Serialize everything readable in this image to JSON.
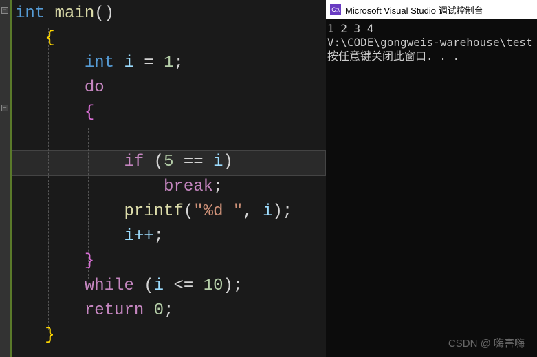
{
  "editor": {
    "tokens": {
      "t_int": "int",
      "t_main": "main",
      "t_lpar": "(",
      "t_rpar": ")",
      "t_lbrace": "{",
      "t_rbrace": "}",
      "t_i": "i",
      "t_eq": "=",
      "t_1": "1",
      "t_semi": ";",
      "t_do": "do",
      "t_if": "if",
      "t_5": "5",
      "t_eqeq": "==",
      "t_break": "break",
      "t_printf": "printf",
      "t_fmt": "\"%d \"",
      "t_comma": ",",
      "t_ipp": "i++",
      "t_while": "while",
      "t_le": "<=",
      "t_10": "10",
      "t_return": "return",
      "t_0": "0"
    }
  },
  "console": {
    "icon_text": "C:\\",
    "title": "Microsoft Visual Studio 调试控制台",
    "line1": "1 2 3 4",
    "line2": "V:\\CODE\\gongweis-warehouse\\test",
    "line3": "按任意键关闭此窗口. . ."
  },
  "watermark": "CSDN @   嗨害嗨"
}
